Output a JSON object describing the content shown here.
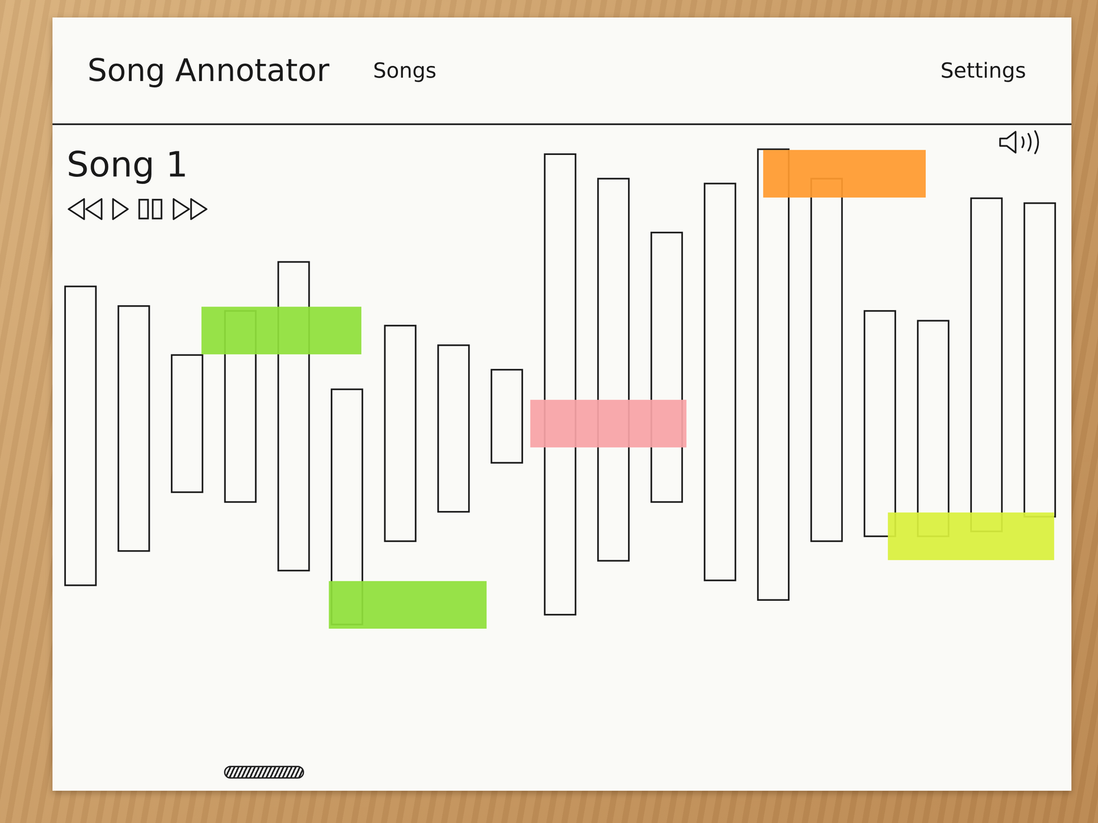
{
  "header": {
    "title": "Song Annotator",
    "nav": [
      "Songs"
    ],
    "settings": "Settings"
  },
  "song": {
    "title": "Song 1"
  },
  "waveform": {
    "bars": [
      {
        "high": 70,
        "low": 9
      },
      {
        "high": 66,
        "low": 16
      },
      {
        "high": 56,
        "low": 28
      },
      {
        "high": 65,
        "low": 26
      },
      {
        "high": 75,
        "low": 12
      },
      {
        "high": 49,
        "low": 1
      },
      {
        "high": 62,
        "low": 18
      },
      {
        "high": 58,
        "low": 24
      },
      {
        "high": 53,
        "low": 34
      },
      {
        "high": 97,
        "low": 3
      },
      {
        "high": 92,
        "low": 14
      },
      {
        "high": 81,
        "low": 26
      },
      {
        "high": 91,
        "low": 10
      },
      {
        "high": 98,
        "low": 6
      },
      {
        "high": 92,
        "low": 18
      },
      {
        "high": 65,
        "low": 19
      },
      {
        "high": 63,
        "low": 19
      },
      {
        "high": 88,
        "low": 20
      },
      {
        "high": 87,
        "low": 23
      }
    ]
  },
  "annotations": [
    {
      "start": 2.27,
      "end": 5.27,
      "value": 61,
      "color": "#8fe03a"
    },
    {
      "start": 4.66,
      "end": 7.62,
      "value": 5,
      "color": "#8fe03a"
    },
    {
      "start": 8.44,
      "end": 11.37,
      "value": 42,
      "color": "#f8a3a6"
    },
    {
      "start": 12.81,
      "end": 15.86,
      "value": 93,
      "color": "#ff9a2e"
    },
    {
      "start": 15.15,
      "end": 18.27,
      "value": 19,
      "color": "#d9f03c"
    }
  ]
}
